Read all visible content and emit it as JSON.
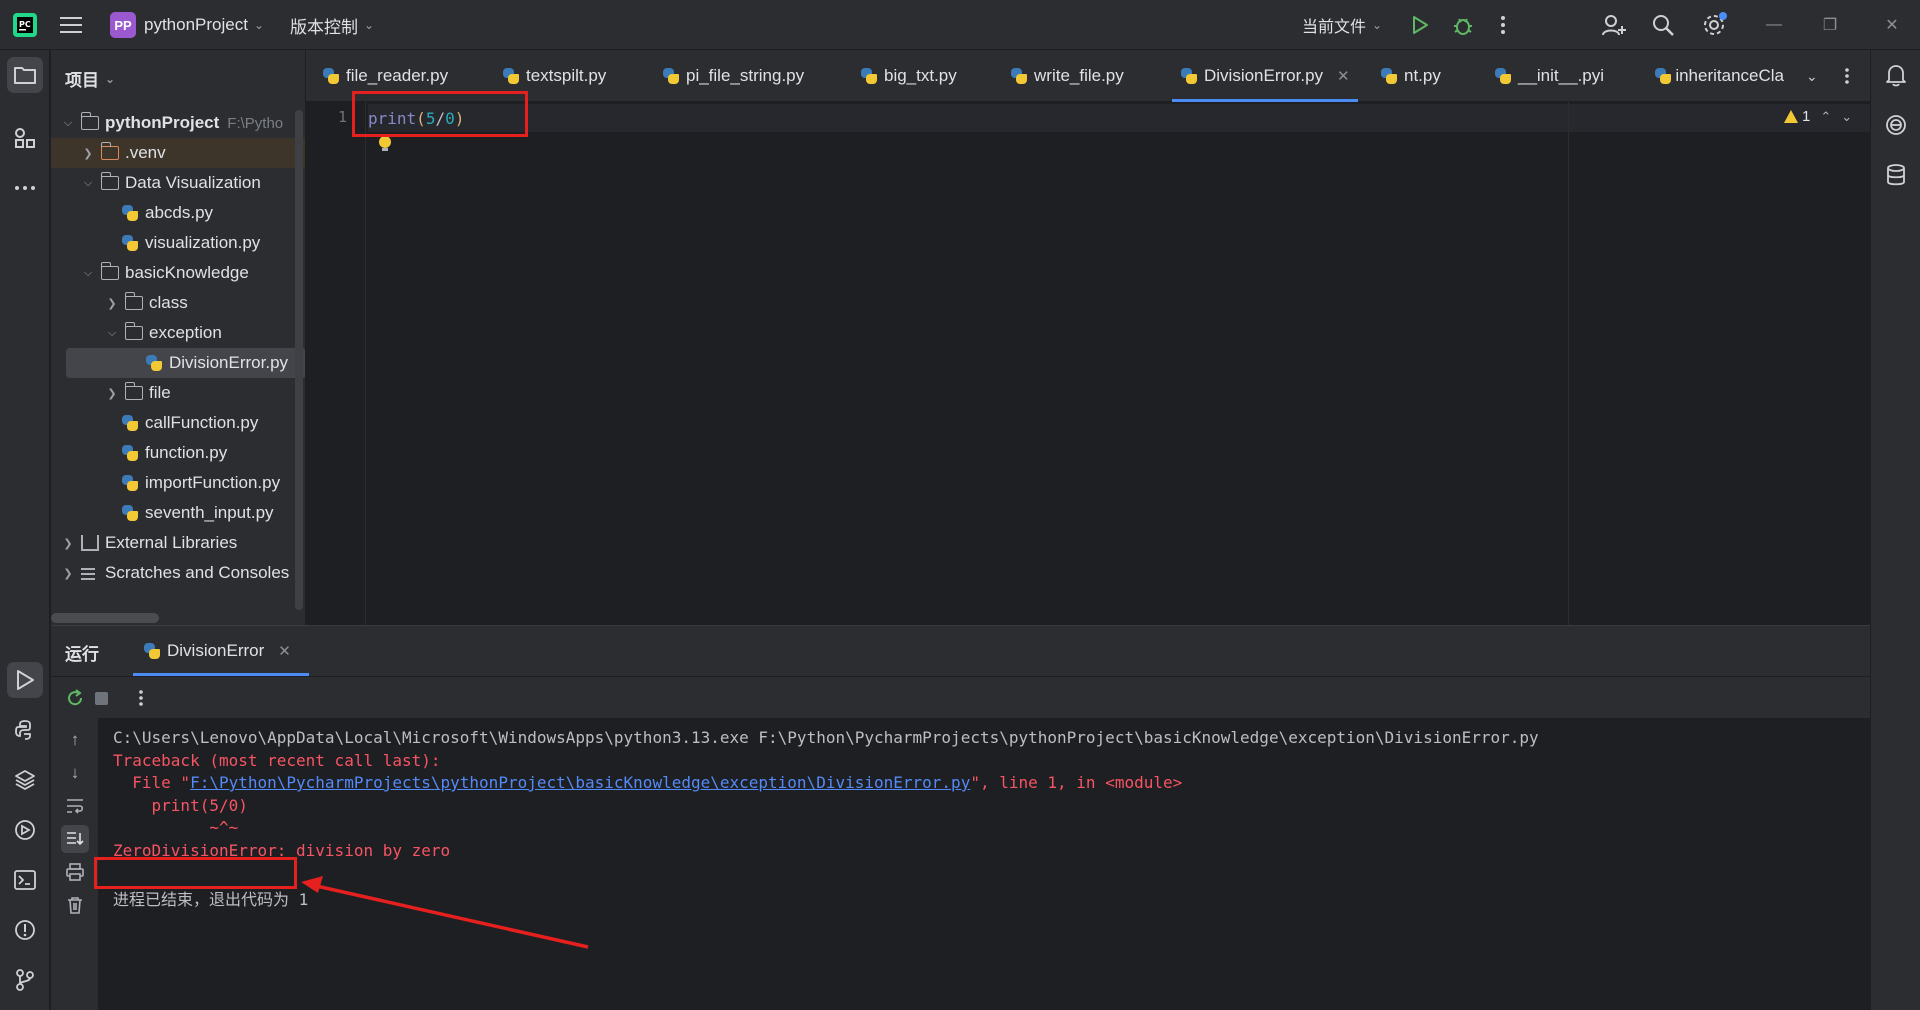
{
  "titlebar": {
    "project_badge": "PP",
    "project_name": "pythonProject",
    "vcs_label": "版本控制",
    "run_config": "当前文件"
  },
  "project_panel": {
    "title": "项目",
    "tree": [
      {
        "label": "pythonProject",
        "path_hint": "F:\\Pytho",
        "type": "folder",
        "expanded": true
      },
      {
        "label": ".venv",
        "type": "folder",
        "expanded": false
      },
      {
        "label": "Data Visualization",
        "type": "folder",
        "expanded": true
      },
      {
        "label": "abcds.py",
        "type": "python"
      },
      {
        "label": "visualization.py",
        "type": "python"
      },
      {
        "label": "basicKnowledge",
        "type": "folder",
        "expanded": true
      },
      {
        "label": "class",
        "type": "folder",
        "expanded": false
      },
      {
        "label": "exception",
        "type": "folder",
        "expanded": true
      },
      {
        "label": "DivisionError.py",
        "type": "python",
        "selected": true
      },
      {
        "label": "file",
        "type": "folder",
        "expanded": false
      },
      {
        "label": "callFunction.py",
        "type": "python"
      },
      {
        "label": "function.py",
        "type": "python"
      },
      {
        "label": "importFunction.py",
        "type": "python"
      },
      {
        "label": "seventh_input.py",
        "type": "python"
      },
      {
        "label": "External Libraries",
        "type": "library",
        "expanded": false
      },
      {
        "label": "Scratches and Consoles",
        "type": "scratch",
        "expanded": false
      }
    ]
  },
  "tabs": [
    {
      "label": "file_reader.py"
    },
    {
      "label": "textspilt.py"
    },
    {
      "label": "pi_file_string.py"
    },
    {
      "label": "big_txt.py"
    },
    {
      "label": "write_file.py"
    },
    {
      "label": "DivisionError.py",
      "active": true
    },
    {
      "label": "nt.py"
    },
    {
      "label": "__init__.pyi"
    },
    {
      "label": "inheritanceCla"
    }
  ],
  "editor": {
    "line_number": "1",
    "code": {
      "fn": "print",
      "open": "(",
      "a": "5",
      "op": "/",
      "b": "0",
      "close": ")"
    },
    "warning_count": "1"
  },
  "run_panel": {
    "title": "运行",
    "tab_label": "DivisionError",
    "console": {
      "command": "C:\\Users\\Lenovo\\AppData\\Local\\Microsoft\\WindowsApps\\python3.13.exe F:\\Python\\PycharmProjects\\pythonProject\\basicKnowledge\\exception\\DivisionError.py",
      "traceback_header": "Traceback (most recent call last):",
      "file_prefix": "  File \"",
      "file_link": "F:\\Python\\PycharmProjects\\pythonProject\\basicKnowledge\\exception\\DivisionError.py",
      "file_suffix": "\", line 1, in <module>",
      "code_line": "    print(5/0)",
      "caret_line": "          ~^~",
      "error_type": "ZeroDivisionError:",
      "error_message": " division by zero",
      "exit_message": "进程已结束，退出代码为 1"
    }
  },
  "colors": {
    "accent": "#4b8cf5",
    "error": "#f75464",
    "annotation": "#e5201f",
    "link": "#548af7"
  }
}
